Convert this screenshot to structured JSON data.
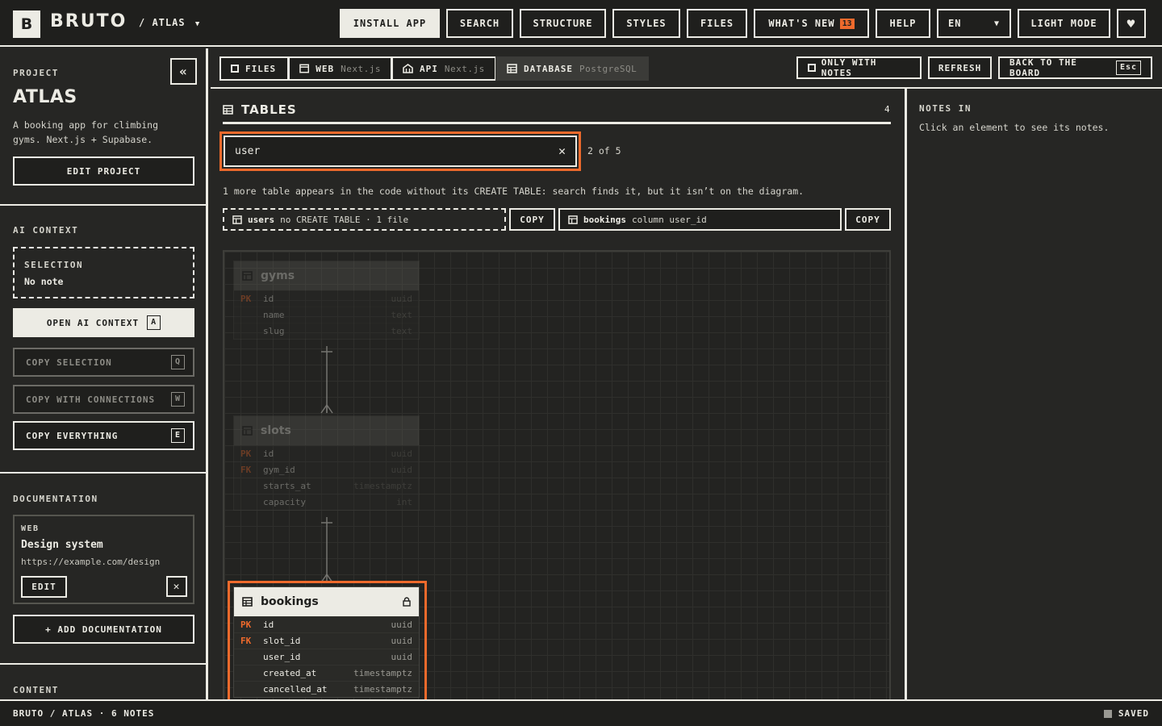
{
  "header": {
    "logo_letter": "B",
    "brand": "BRUTO",
    "project_crumb": "/ ATLAS",
    "buttons": {
      "install": "INSTALL APP",
      "search": "SEARCH",
      "structure": "STRUCTURE",
      "styles": "STYLES",
      "files": "FILES",
      "whats_new": "WHAT'S NEW",
      "whats_new_count": "13",
      "help": "HELP",
      "language": "EN",
      "light_mode": "LIGHT MODE"
    }
  },
  "sidebar": {
    "project_label": "PROJECT",
    "project_name": "ATLAS",
    "project_desc": "A booking app for climbing gyms. Next.js + Supabase.",
    "edit_project": "EDIT PROJECT",
    "ai_context_label": "AI CONTEXT",
    "selection_label": "SELECTION",
    "selection_value": "No note",
    "open_ai_context": "OPEN AI CONTEXT",
    "open_ai_key": "A",
    "copy_selection": "COPY SELECTION",
    "copy_selection_key": "Q",
    "copy_connections": "COPY WITH CONNECTIONS",
    "copy_connections_key": "W",
    "copy_everything": "COPY EVERYTHING",
    "copy_everything_key": "E",
    "documentation_label": "DOCUMENTATION",
    "doc": {
      "kind": "WEB",
      "title": "Design system",
      "url": "https://example.com/design",
      "edit": "EDIT"
    },
    "add_documentation": "+ ADD DOCUMENTATION",
    "content_label": "CONTENT"
  },
  "tabs": [
    {
      "label": "FILES",
      "sub": ""
    },
    {
      "label": "WEB",
      "sub": "Next.js"
    },
    {
      "label": "API",
      "sub": "Next.js"
    },
    {
      "label": "DATABASE",
      "sub": "PostgreSQL"
    }
  ],
  "toolbar": {
    "only_with_notes": "ONLY WITH NOTES",
    "refresh": "REFRESH",
    "back": "BACK TO THE BOARD",
    "back_key": "Esc"
  },
  "tables_panel": {
    "title": "TABLES",
    "count": "4",
    "search_value": "user",
    "match_count": "2 of 5",
    "info": "1 more table appears in the code without its CREATE TABLE: search finds it, but it isn’t on the diagram.",
    "chips": [
      {
        "name": "users",
        "detail": "no CREATE TABLE · 1 file",
        "copy": "COPY"
      },
      {
        "name": "bookings",
        "detail": "column user_id",
        "copy": "COPY"
      }
    ]
  },
  "diagram": {
    "tables": [
      {
        "name": "gyms",
        "rows": [
          {
            "key": "PK",
            "col": "id",
            "type": "uuid"
          },
          {
            "key": "",
            "col": "name",
            "type": "text"
          },
          {
            "key": "",
            "col": "slug",
            "type": "text"
          }
        ]
      },
      {
        "name": "slots",
        "rows": [
          {
            "key": "PK",
            "col": "id",
            "type": "uuid"
          },
          {
            "key": "FK",
            "col": "gym_id",
            "type": "uuid"
          },
          {
            "key": "",
            "col": "starts_at",
            "type": "timestamptz"
          },
          {
            "key": "",
            "col": "capacity",
            "type": "int"
          }
        ]
      },
      {
        "name": "bookings",
        "rows": [
          {
            "key": "PK",
            "col": "id",
            "type": "uuid"
          },
          {
            "key": "FK",
            "col": "slot_id",
            "type": "uuid"
          },
          {
            "key": "",
            "col": "user_id",
            "type": "uuid"
          },
          {
            "key": "",
            "col": "created_at",
            "type": "timestamptz"
          },
          {
            "key": "",
            "col": "cancelled_at",
            "type": "timestamptz"
          }
        ]
      }
    ]
  },
  "notes_pane": {
    "title": "NOTES IN",
    "hint": "Click an element to see its notes."
  },
  "footer": {
    "path": "BRUTO / ATLAS · 6 NOTES",
    "status": "SAVED"
  },
  "colors": {
    "accent": "#ee6a2c",
    "background": "#262624",
    "foreground": "#ecebe4"
  }
}
